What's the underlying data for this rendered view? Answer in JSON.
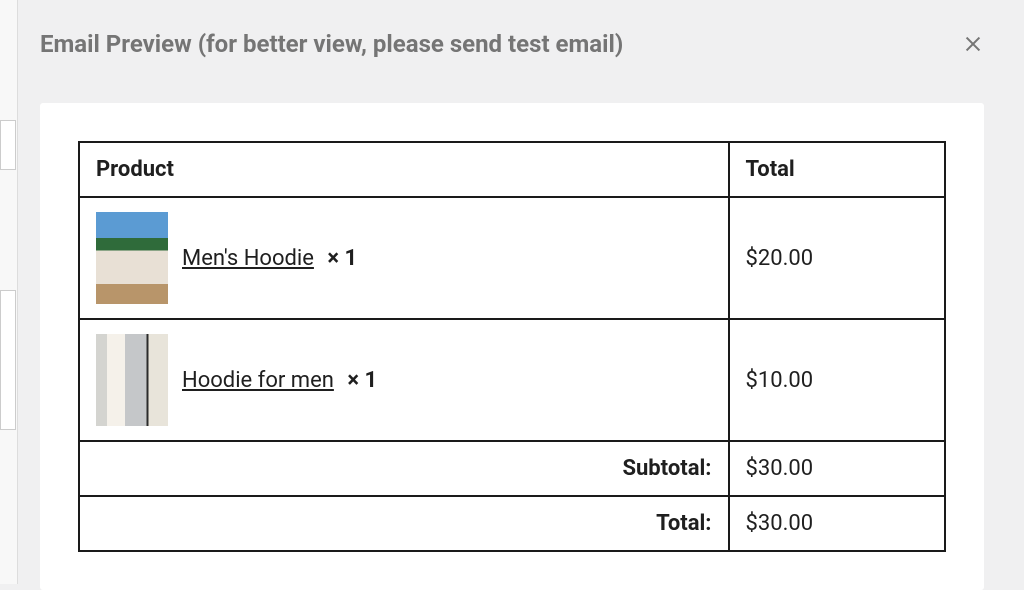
{
  "header": {
    "title": "Email Preview (for better view, please send test email)"
  },
  "table": {
    "columns": {
      "product": "Product",
      "total": "Total"
    },
    "items": [
      {
        "name": "Men's Hoodie",
        "qty": "× 1",
        "price": "$20.00"
      },
      {
        "name": "Hoodie for men",
        "qty": "× 1",
        "price": "$10.00"
      }
    ],
    "summary": {
      "subtotal_label": "Subtotal:",
      "subtotal_value": "$30.00",
      "total_label": "Total:",
      "total_value": "$30.00"
    }
  }
}
